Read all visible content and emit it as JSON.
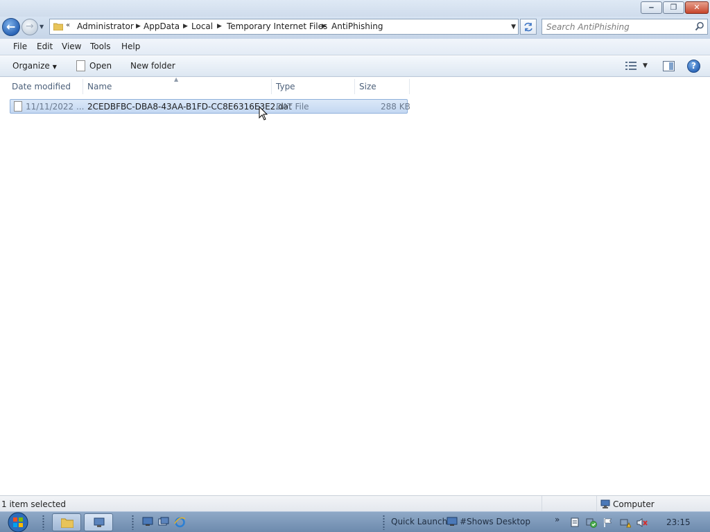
{
  "window": {
    "caption_buttons": {
      "minimize_icon": "minimize-icon",
      "restore_icon": "restore-icon",
      "close_icon": "close-icon"
    }
  },
  "address": {
    "overflow": "«",
    "breadcrumbs": [
      "Administrator",
      "AppData",
      "Local",
      "Temporary Internet Files",
      "AntiPhishing"
    ]
  },
  "search": {
    "placeholder": "Search AntiPhishing"
  },
  "menu": {
    "items": [
      "File",
      "Edit",
      "View",
      "Tools",
      "Help"
    ]
  },
  "toolbar": {
    "organize": "Organize",
    "open": "Open",
    "new_folder": "New folder"
  },
  "columns": {
    "date_modified": "Date modified",
    "name": "Name",
    "type": "Type",
    "size": "Size"
  },
  "files": [
    {
      "date_modified": "11/11/2022 ...",
      "name": "2CEDBFBC-DBA8-43AA-B1FD-CC8E6316E3E2.dat",
      "type": "DAT File",
      "size": "288 KB",
      "selected": true
    }
  ],
  "status": {
    "selection": "1 item selected",
    "location": "Computer"
  },
  "taskbar": {
    "quick_launch": "Quick Launch",
    "show_desktop": "#Shows Desktop",
    "overflow": "»",
    "clock": "23:15"
  },
  "colors": {
    "selection": "#c4d8f2",
    "taskbar": "#7d98bb",
    "accent": "#2a64b6"
  }
}
